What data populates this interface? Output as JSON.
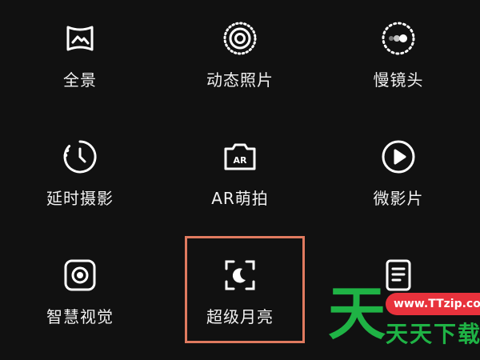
{
  "modes": [
    {
      "id": "panorama",
      "label": "全景",
      "icon": "panorama-icon"
    },
    {
      "id": "live-photo",
      "label": "动态照片",
      "icon": "live-photo-icon"
    },
    {
      "id": "slow-motion",
      "label": "慢镜头",
      "icon": "slow-motion-icon"
    },
    {
      "id": "time-lapse",
      "label": "延时摄影",
      "icon": "timer-icon"
    },
    {
      "id": "ar",
      "label": "AR萌拍",
      "icon": "ar-camera-icon"
    },
    {
      "id": "micro-movie",
      "label": "微影片",
      "icon": "play-icon"
    },
    {
      "id": "smart-vision",
      "label": "智慧视觉",
      "icon": "smart-vision-icon"
    },
    {
      "id": "super-moon",
      "label": "超级月亮",
      "icon": "moon-focus-icon"
    },
    {
      "id": "document",
      "label": "",
      "icon": "document-icon"
    }
  ],
  "ar_icon_text": "AR",
  "highlighted_mode": "super-moon",
  "colors": {
    "background": "#111111",
    "highlight": "#e07a5f",
    "watermark_green": "#1fb345",
    "watermark_red": "#e8323c"
  },
  "watermark": {
    "big_char": "天",
    "url": "www.TTzip.com",
    "text": "天天下载"
  }
}
